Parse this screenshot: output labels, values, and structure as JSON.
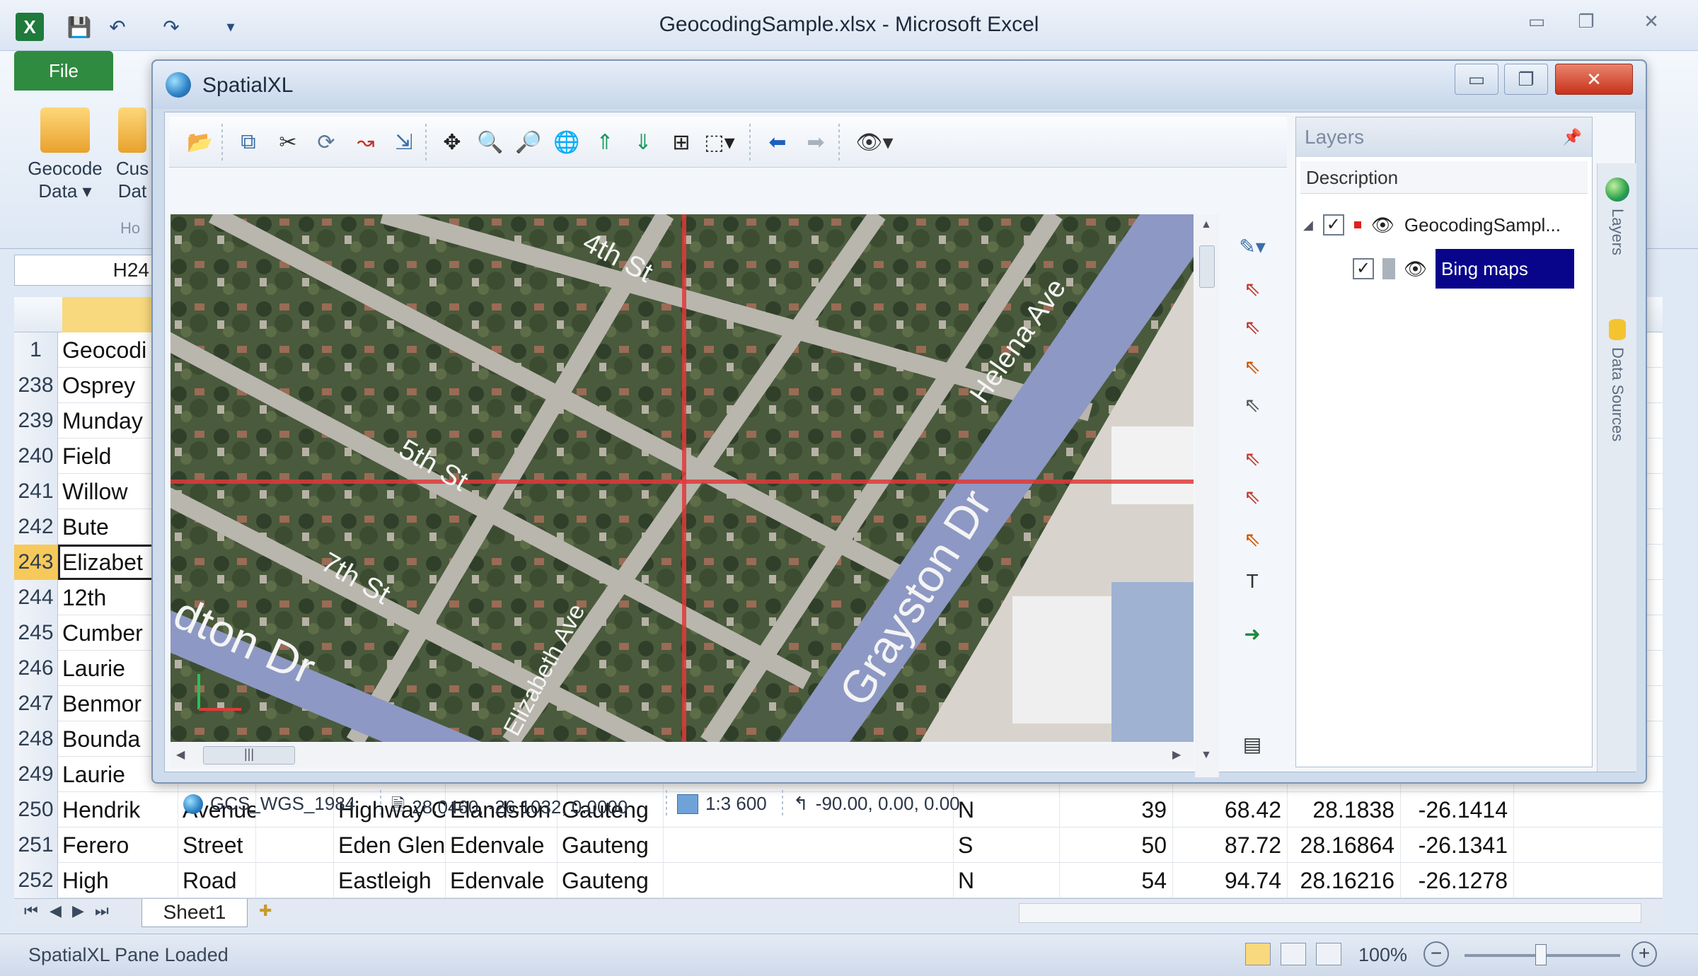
{
  "excel": {
    "title": "GeocodingSample.xlsx - Microsoft Excel",
    "file_tab": "File",
    "ribbon_buttons": [
      {
        "label": "Geocode\nData ▾"
      },
      {
        "label": "Cus\nDat"
      }
    ],
    "ribbon_group_label": "Ho",
    "namebox": "H24",
    "rows": [
      {
        "num": "1",
        "a": "Geocodi",
        "b": "",
        "c": "",
        "d": "",
        "e": "",
        "f": "",
        "g": "",
        "h": "",
        "i": "",
        "j": "",
        "k": "",
        "l": ""
      },
      {
        "num": "238",
        "a": "Osprey"
      },
      {
        "num": "239",
        "a": "Munday"
      },
      {
        "num": "240",
        "a": "Field"
      },
      {
        "num": "241",
        "a": "Willow"
      },
      {
        "num": "242",
        "a": "Bute"
      },
      {
        "num": "243",
        "a": "Elizabet",
        "active": true
      },
      {
        "num": "244",
        "a": "12th"
      },
      {
        "num": "245",
        "a": "Cumber"
      },
      {
        "num": "246",
        "a": "Laurie"
      },
      {
        "num": "247",
        "a": "Benmor"
      },
      {
        "num": "248",
        "a": "Bounda"
      },
      {
        "num": "249",
        "a": "Laurie"
      },
      {
        "num": "250",
        "a": "Hendrik",
        "b": "Avenue",
        "d": "Highway C",
        "e": "Elandsfon",
        "f": "Gauteng",
        "h": "N",
        "i": "39",
        "j": "68.42",
        "k": "28.1838",
        "l": "-26.1414"
      },
      {
        "num": "251",
        "a": "Ferero",
        "b": "Street",
        "d": "Eden Glen",
        "e": "Edenvale",
        "f": "Gauteng",
        "h": "S",
        "i": "50",
        "j": "87.72",
        "k": "28.16864",
        "l": "-26.1341"
      },
      {
        "num": "252",
        "a": "High",
        "b": "Road",
        "d": "Eastleigh",
        "e": "Edenvale",
        "f": "Gauteng",
        "h": "N",
        "i": "54",
        "j": "94.74",
        "k": "28.16216",
        "l": "-26.1278"
      }
    ],
    "sheet_tab": "Sheet1",
    "status_text": "SpatialXL Pane Loaded",
    "zoom": "100%"
  },
  "spatial": {
    "title": "SpatialXL",
    "status": {
      "crs": "GCS_WGS_1984",
      "coords": "28.0460, -26.1032, 0.0000",
      "scale": "1:3 600",
      "rotation": "-90.00, 0.00, 0.00"
    },
    "map_labels": {
      "fifth": "5th St",
      "seventh": "7th St",
      "fourth": "4th St",
      "elizabeth": "Elizabeth Ave",
      "helena": "Helena Ave",
      "grayston": "Grayston Dr",
      "rivonia": "dton Dr"
    },
    "layers": {
      "header": "Layers",
      "column": "Description",
      "items": [
        {
          "label": "GeocodingSampl...",
          "checked": true
        },
        {
          "label": "Bing maps",
          "checked": true,
          "selected": true
        }
      ]
    },
    "rail_tabs": [
      "Layers",
      "Data Sources"
    ]
  }
}
